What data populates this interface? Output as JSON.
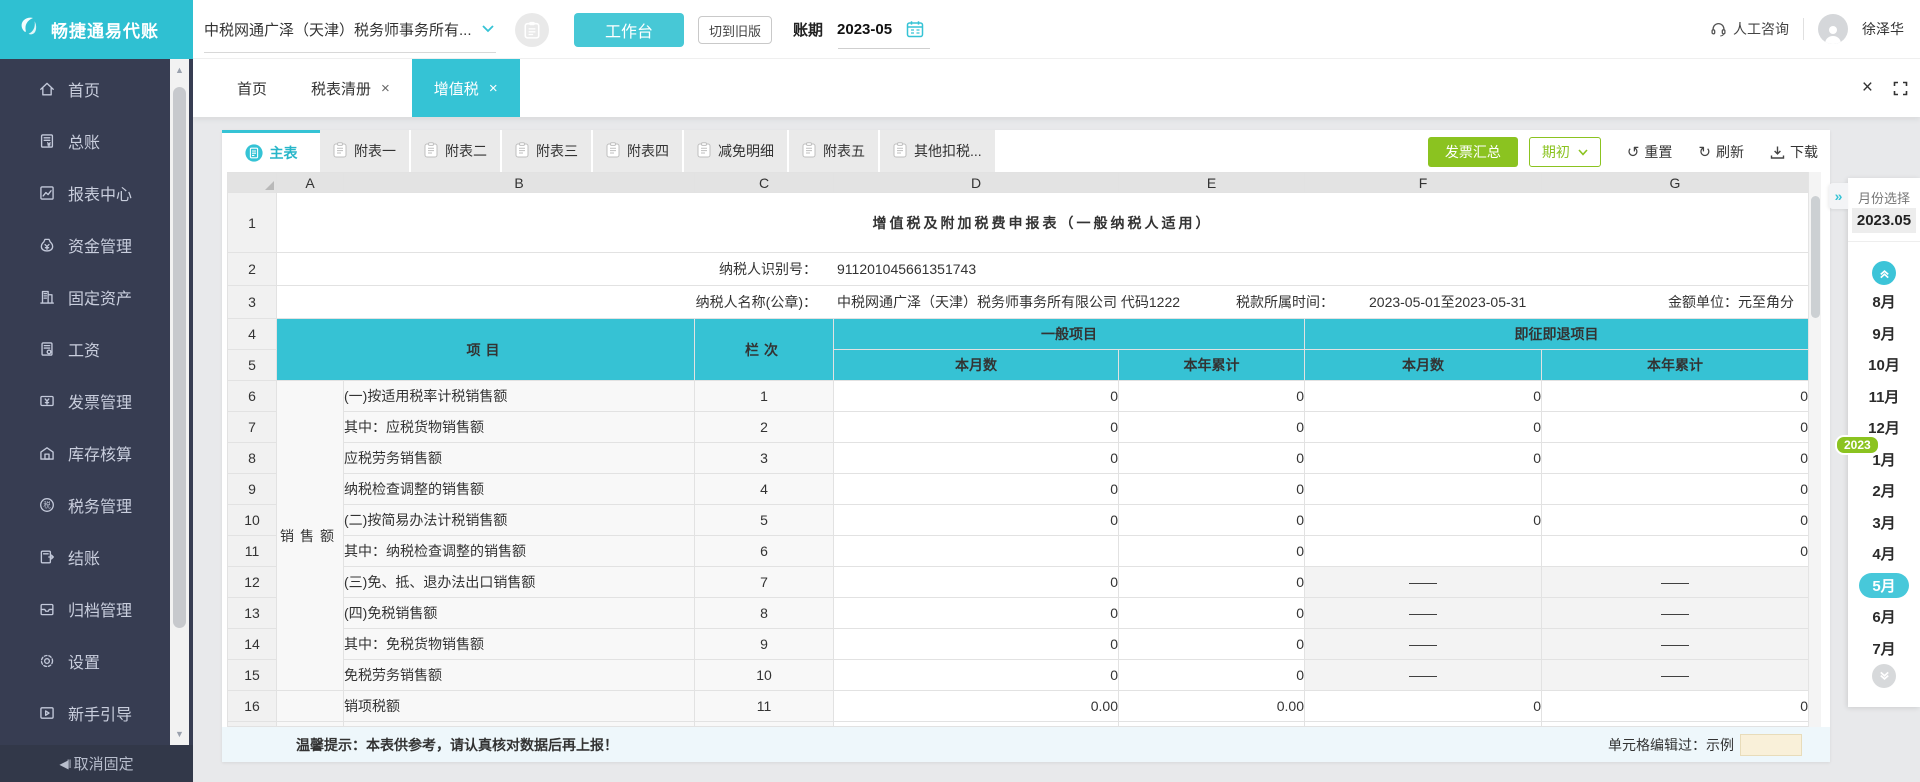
{
  "brand": {
    "name": "畅捷通易代账"
  },
  "topbar": {
    "company": "中税网通广泽（天津）税务师事务所有...",
    "workbench": "工作台",
    "switch_old": "切到旧版",
    "period_label": "账期",
    "period_value": "2023-05",
    "support": "人工咨询",
    "username": "徐泽华"
  },
  "tabs": [
    {
      "label": "首页",
      "closable": false
    },
    {
      "label": "税表清册",
      "closable": true
    },
    {
      "label": "增值税",
      "closable": true,
      "active": true
    }
  ],
  "subtabs": {
    "active": "主表",
    "items": [
      "附表一",
      "附表二",
      "附表三",
      "附表四",
      "减免明细",
      "附表五",
      "其他扣税..."
    ]
  },
  "toolbar": {
    "invoice_summary": "发票汇总",
    "opening": "期初",
    "reset": "重置",
    "refresh": "刷新",
    "download": "下载"
  },
  "sidebar": {
    "items": [
      {
        "id": "home",
        "icon": "home-icon",
        "label": "首页"
      },
      {
        "id": "ledger",
        "icon": "ledger-icon",
        "label": "总账"
      },
      {
        "id": "reports",
        "icon": "report-chart-icon",
        "label": "报表中心"
      },
      {
        "id": "funds",
        "icon": "money-bag-icon",
        "label": "资金管理"
      },
      {
        "id": "assets",
        "icon": "building-icon",
        "label": "固定资产"
      },
      {
        "id": "payroll",
        "icon": "payroll-doc-icon",
        "label": "工资"
      },
      {
        "id": "invoice",
        "icon": "invoice-icon",
        "label": "发票管理"
      },
      {
        "id": "inventory",
        "icon": "warehouse-icon",
        "label": "库存核算"
      },
      {
        "id": "tax",
        "icon": "tax-coin-icon",
        "label": "税务管理"
      },
      {
        "id": "closing",
        "icon": "closing-book-icon",
        "label": "结账"
      },
      {
        "id": "archive",
        "icon": "archive-tray-icon",
        "label": "归档管理"
      },
      {
        "id": "settings",
        "icon": "gear-icon",
        "label": "设置"
      },
      {
        "id": "guide",
        "icon": "guide-play-icon",
        "label": "新手引导"
      }
    ],
    "unpin": "取消固定"
  },
  "sheet": {
    "columns": [
      "A",
      "B",
      "C",
      "D",
      "E",
      "F",
      "G"
    ],
    "title": "增值税及附加税费申报表（一般纳税人适用）",
    "taxpayer_id_label": "纳税人识别号：",
    "taxpayer_id": "911201045661351743",
    "taxpayer_name_label": "纳税人名称(公章)：",
    "taxpayer_name": "中税网通广泽（天津）税务师事务所有限公司 代码1222",
    "tax_period_label": "税款所属时间：",
    "tax_period": "2023-05-01至2023-05-31",
    "unit_label": "金额单位：",
    "unit": "元至角分",
    "thead": {
      "item": "项目",
      "column_no": "栏次",
      "general": "一般项目",
      "immediate_refund": "即征即退项目",
      "current_month": "本月数",
      "ytd": "本年累计"
    },
    "sales_group_label": "销售额",
    "rows": [
      {
        "num": "6",
        "item": "(一)按适用税率计税销售额",
        "line": "1",
        "d": "0",
        "e": "0",
        "f": "0",
        "g": "0"
      },
      {
        "num": "7",
        "item": "其中：应税货物销售额",
        "line": "2",
        "d": "0",
        "e": "0",
        "f": "0",
        "g": "0"
      },
      {
        "num": "8",
        "item": "应税劳务销售额",
        "line": "3",
        "d": "0",
        "e": "0",
        "f": "0",
        "g": "0"
      },
      {
        "num": "9",
        "item": "纳税检查调整的销售额",
        "line": "4",
        "d": "0",
        "e": "0",
        "f": "",
        "g": "0"
      },
      {
        "num": "10",
        "item": "(二)按简易办法计税销售额",
        "line": "5",
        "d": "0",
        "e": "0",
        "f": "0",
        "g": "0"
      },
      {
        "num": "11",
        "item": "其中：纳税检查调整的销售额",
        "line": "6",
        "d": "",
        "e": "0",
        "f": "",
        "g": "0"
      },
      {
        "num": "12",
        "item": "(三)免、抵、退办法出口销售额",
        "line": "7",
        "d": "0",
        "e": "0",
        "f": "——",
        "g": "——"
      },
      {
        "num": "13",
        "item": "(四)免税销售额",
        "line": "8",
        "d": "0",
        "e": "0",
        "f": "——",
        "g": "——"
      },
      {
        "num": "14",
        "item": "其中：免税货物销售额",
        "line": "9",
        "d": "0",
        "e": "0",
        "f": "——",
        "g": "——"
      },
      {
        "num": "15",
        "item": "免税劳务销售额",
        "line": "10",
        "d": "0",
        "e": "0",
        "f": "——",
        "g": "——"
      },
      {
        "num": "16",
        "item": "销项税额",
        "line": "11",
        "d": "0.00",
        "e": "0.00",
        "f": "0",
        "g": "0"
      }
    ]
  },
  "card_footer": {
    "tip": "温馨提示：本表供参考，请认真核对数据后再上报！",
    "edited_label": "单元格编辑过：",
    "edited_sample": "示例"
  },
  "month_panel": {
    "title": "月份选择",
    "current": "2023.05",
    "year_badge": "2023",
    "months": [
      "8月",
      "9月",
      "10月",
      "11月",
      "12月",
      "1月",
      "2月",
      "3月",
      "4月",
      "5月",
      "6月",
      "7月"
    ],
    "selected": "5月"
  }
}
